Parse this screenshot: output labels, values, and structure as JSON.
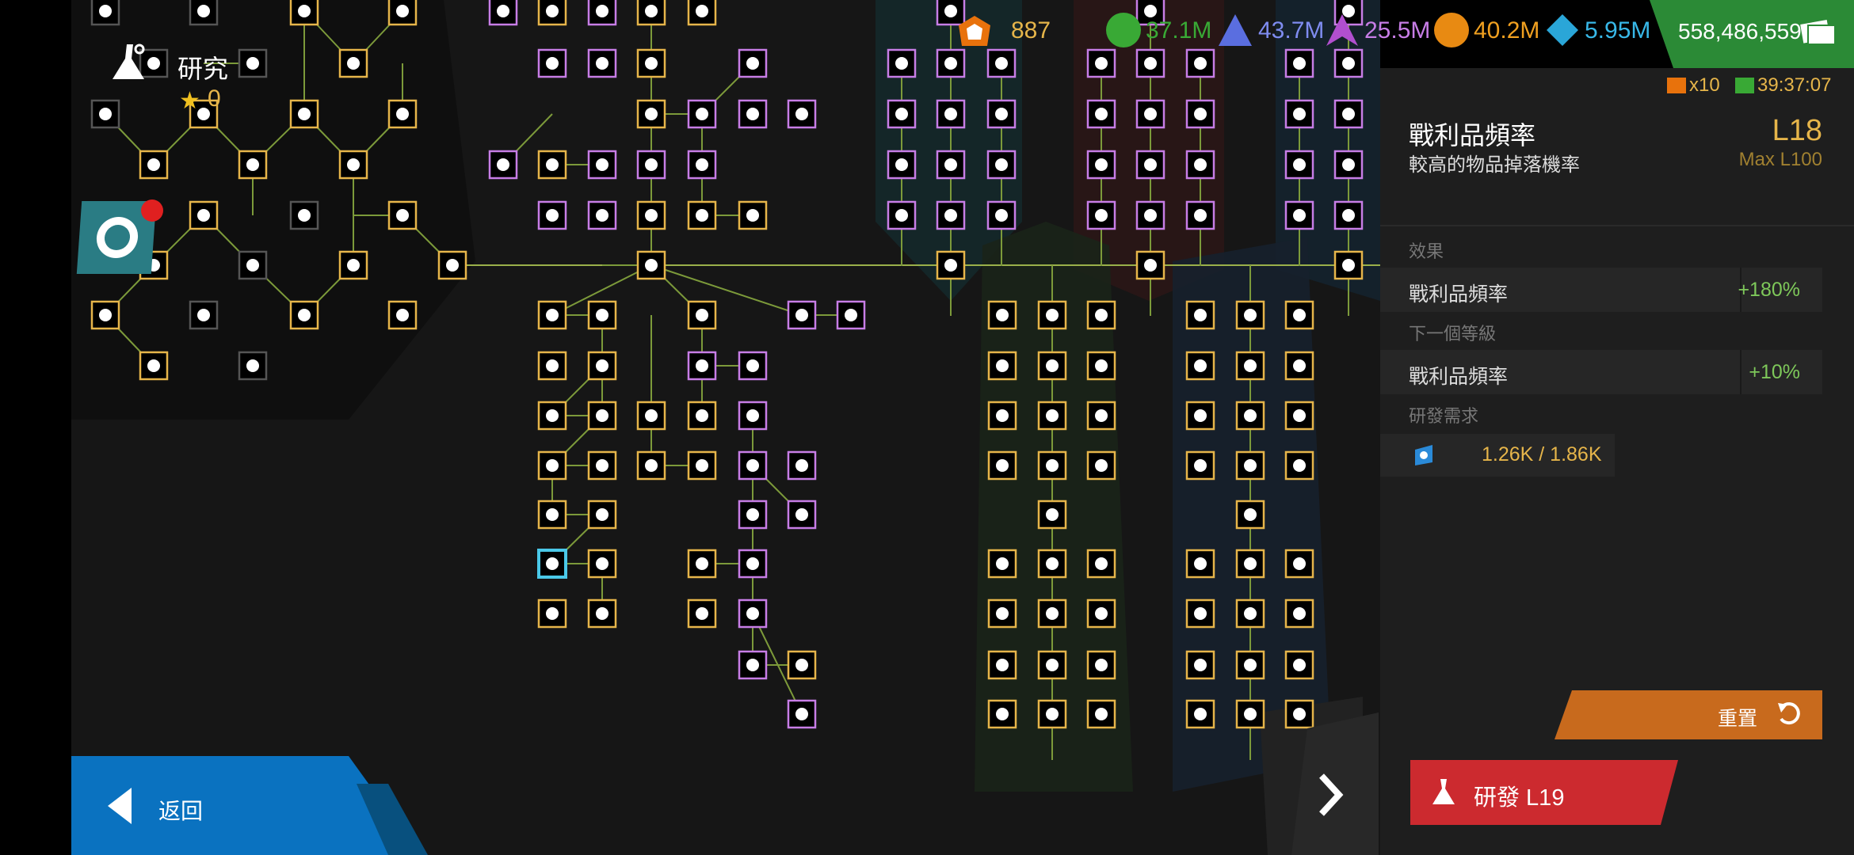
{
  "screen_title": "研究",
  "stars": "0",
  "currencies": {
    "gems": "887",
    "res_green": "37.1M",
    "res_blue": "43.7M",
    "res_purple": "25.5M",
    "res_orange": "40.2M",
    "res_cyan": "5.95M",
    "cash": "558,486,559"
  },
  "timers": {
    "tickets": "x10",
    "time": "39:37:07"
  },
  "detail": {
    "name": "戰利品頻率",
    "level": "L18",
    "description": "較高的物品掉落機率",
    "max_level": "Max L100",
    "effect_header": "效果",
    "effect_label": "戰利品頻率",
    "effect_value": "+180%",
    "next_header": "下一個等級",
    "next_label": "戰利品頻率",
    "next_value": "+10%",
    "req_header": "研發需求",
    "req_value": "1.26K / 1.86K",
    "reset_label": "重置",
    "research_label": "研發 L19"
  },
  "back_label": "返回",
  "colors": {
    "gold": "#e6b54a",
    "purple": "#c77de6",
    "green_text": "#7ec85a",
    "research_red": "#cc2a2f",
    "reset_orange": "#c86a1d",
    "back_blue": "#0a72c0",
    "cash_green": "#2b8a36"
  }
}
